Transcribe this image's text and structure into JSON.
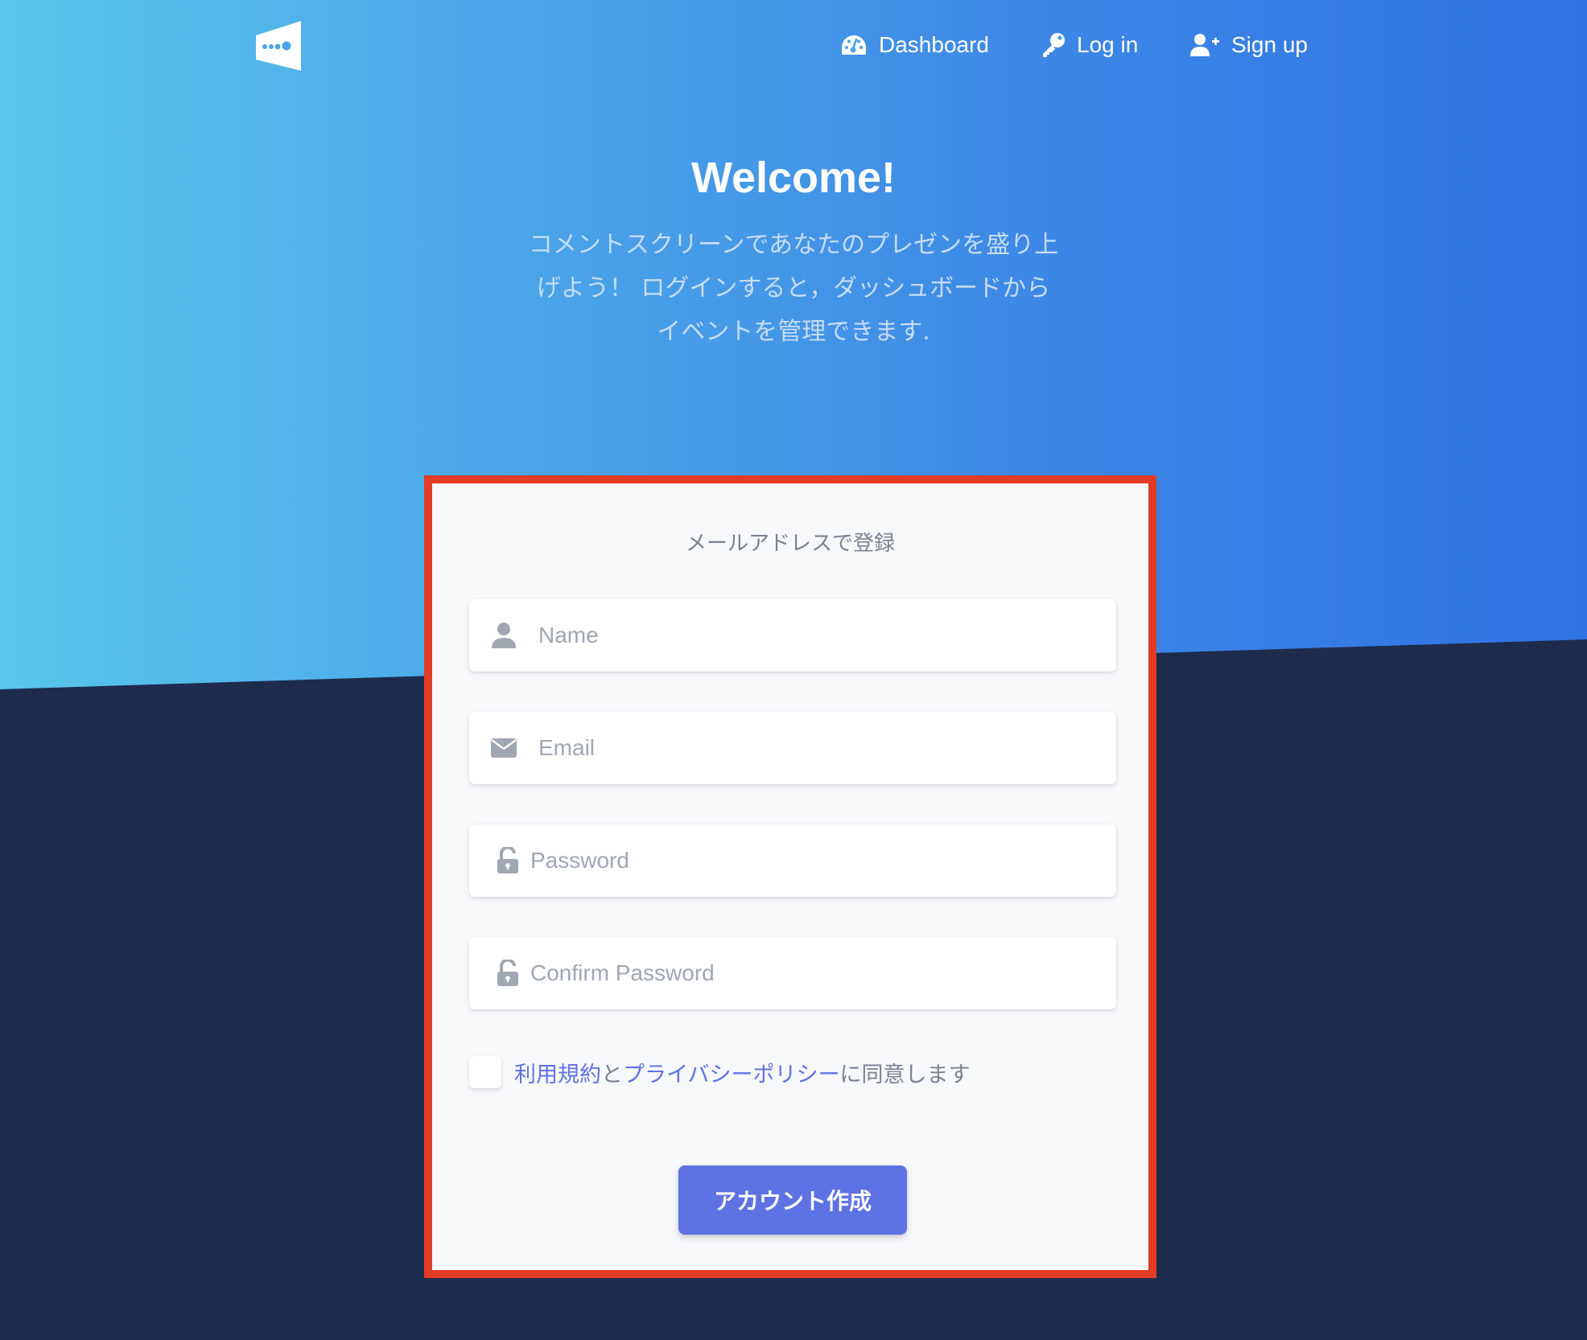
{
  "nav": {
    "items": [
      {
        "label": "Dashboard",
        "icon": "dashboard-gauge-icon"
      },
      {
        "label": "Log in",
        "icon": "key-icon"
      },
      {
        "label": "Sign up",
        "icon": "user-plus-icon"
      }
    ]
  },
  "hero": {
    "title": "Welcome!",
    "lead": "コメントスクリーンであなたのプレゼンを盛り上げよう！ ログインすると，ダッシュボードからイベントを管理できます."
  },
  "form": {
    "title": "メールアドレスで登録",
    "fields": {
      "name": {
        "placeholder": "Name",
        "value": "",
        "icon": "user-icon"
      },
      "email": {
        "placeholder": "Email",
        "value": "",
        "icon": "envelope-icon"
      },
      "password": {
        "placeholder": "Password",
        "value": "",
        "icon": "unlock-icon"
      },
      "confirm_password": {
        "placeholder": "Confirm Password",
        "value": "",
        "icon": "unlock-icon"
      }
    },
    "agree": {
      "terms_link": "利用規約",
      "connector": "と",
      "privacy_link": "プライバシーポリシー",
      "suffix": "に同意します",
      "checked": false
    },
    "submit_label": "アカウント作成"
  },
  "colors": {
    "hero_gradient_start": "#58c6ec",
    "hero_gradient_end": "#2f73e3",
    "background_dark": "#1d2b4d",
    "primary": "#5e72e4",
    "highlight_outline": "#e23b26",
    "card": "#f7f8fa"
  }
}
